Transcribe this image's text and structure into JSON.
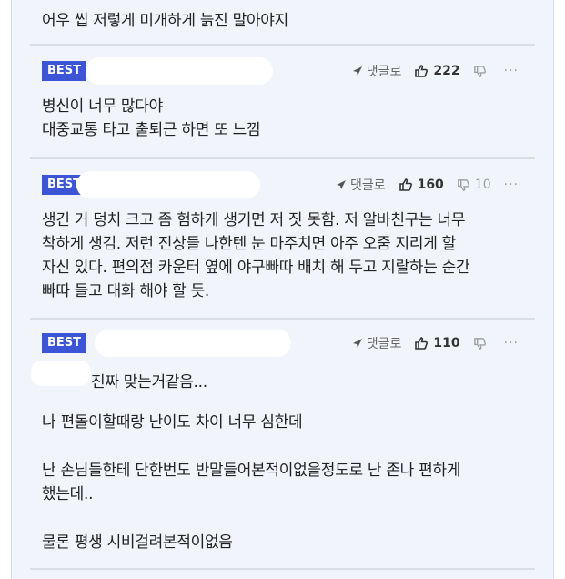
{
  "top_comment": {
    "text": "어우 씹 저렇게 미개하게 늙진 말아야지"
  },
  "comments": [
    {
      "badge": "BEST",
      "reply_label": "댓글로",
      "likes": "222",
      "dislikes": "",
      "more": "···",
      "lines": [
        "병신이 너무 많다야",
        "대중교통 타고 출퇴근 하면 또 느낌"
      ]
    },
    {
      "badge": "BEST",
      "reply_label": "댓글로",
      "likes": "160",
      "dislikes": "10",
      "more": "···",
      "lines": [
        "생긴 거 덩치 크고 좀 험하게 생기면 저 짓 못함. 저 알바친구는 너무",
        "착하게 생김. 저런 진상들 나한텐 눈 마주치면 아주 오줌 지리게 할",
        "자신 있다. 편의점 카운터 옆에 야구빠따 배치 해 두고 지랄하는 순간",
        "빠따 들고 대화 해야 할 듯."
      ]
    },
    {
      "badge": "BEST",
      "reply_label": "댓글로",
      "likes": "110",
      "dislikes": "",
      "more": "···",
      "lines": [
        "진짜 맞는거같음...",
        "나 편돌이할때랑 난이도 차이 너무 심한데",
        "난 손님들한테 단한번도 반말들어본적이없을정도로 난 존나 편하게",
        "했는데..",
        "물론 평생 시비걸려본적이없음"
      ]
    }
  ],
  "colors": {
    "badge_bg": "#3b55d6",
    "panel_bg": "#f1f4fb"
  }
}
